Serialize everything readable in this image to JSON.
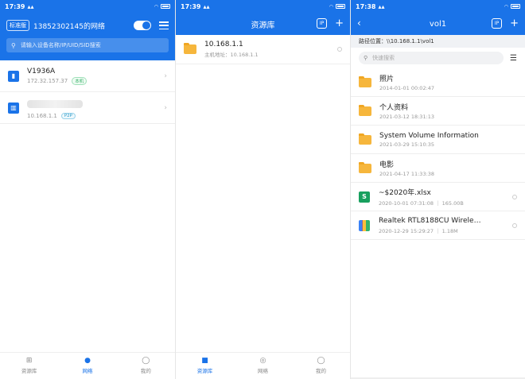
{
  "status": {
    "p1_time": "17:39",
    "p2_time": "17:39",
    "p3_time": "17:38"
  },
  "network": {
    "chip": "标准版",
    "name": "13852302145的网络",
    "search_placeholder": "请输入设备名称/IP/UID/SID搜索",
    "devices": [
      {
        "name": "V1936A",
        "ip": "172.32.157.37",
        "tag": "本机"
      },
      {
        "name": "",
        "ip": "10.168.1.1",
        "tag": "P2P"
      }
    ]
  },
  "tabs": {
    "library": "资源库",
    "network": "网络",
    "mine": "我的"
  },
  "library": {
    "title": "资源库",
    "header_icon": "IP",
    "items": [
      {
        "name": "10.168.1.1",
        "sub": "主机地址：10.168.1.1"
      }
    ]
  },
  "vol": {
    "title": "vol1",
    "header_icon": "IP",
    "path": "路径位置：\\\\10.168.1.1\\vol1",
    "search_placeholder": "快速搜索",
    "files": [
      {
        "name": "照片",
        "sub": "2014-01-01 00:02:47",
        "kind": "folder"
      },
      {
        "name": "个人资料",
        "sub": "2021-03-12 18:31:13",
        "kind": "folder"
      },
      {
        "name": "System Volume Information",
        "sub": "2021-03-29 15:10:35",
        "kind": "folder"
      },
      {
        "name": "电影",
        "sub": "2021-04-17 11:33:38",
        "kind": "folder"
      },
      {
        "name": "~$2020年.xlsx",
        "sub": "2020-10-01 07:31:08 ｜ 165.00B",
        "kind": "xlsx"
      },
      {
        "name": "Realtek RTL8188CU Wirele…",
        "sub": "2020-12-29 15:29:27 ｜ 1.18M",
        "kind": "rar"
      }
    ]
  },
  "colors": {
    "accent": "#1a73e8",
    "folder": "#f6b63c",
    "xlsx": "#18a05e"
  }
}
